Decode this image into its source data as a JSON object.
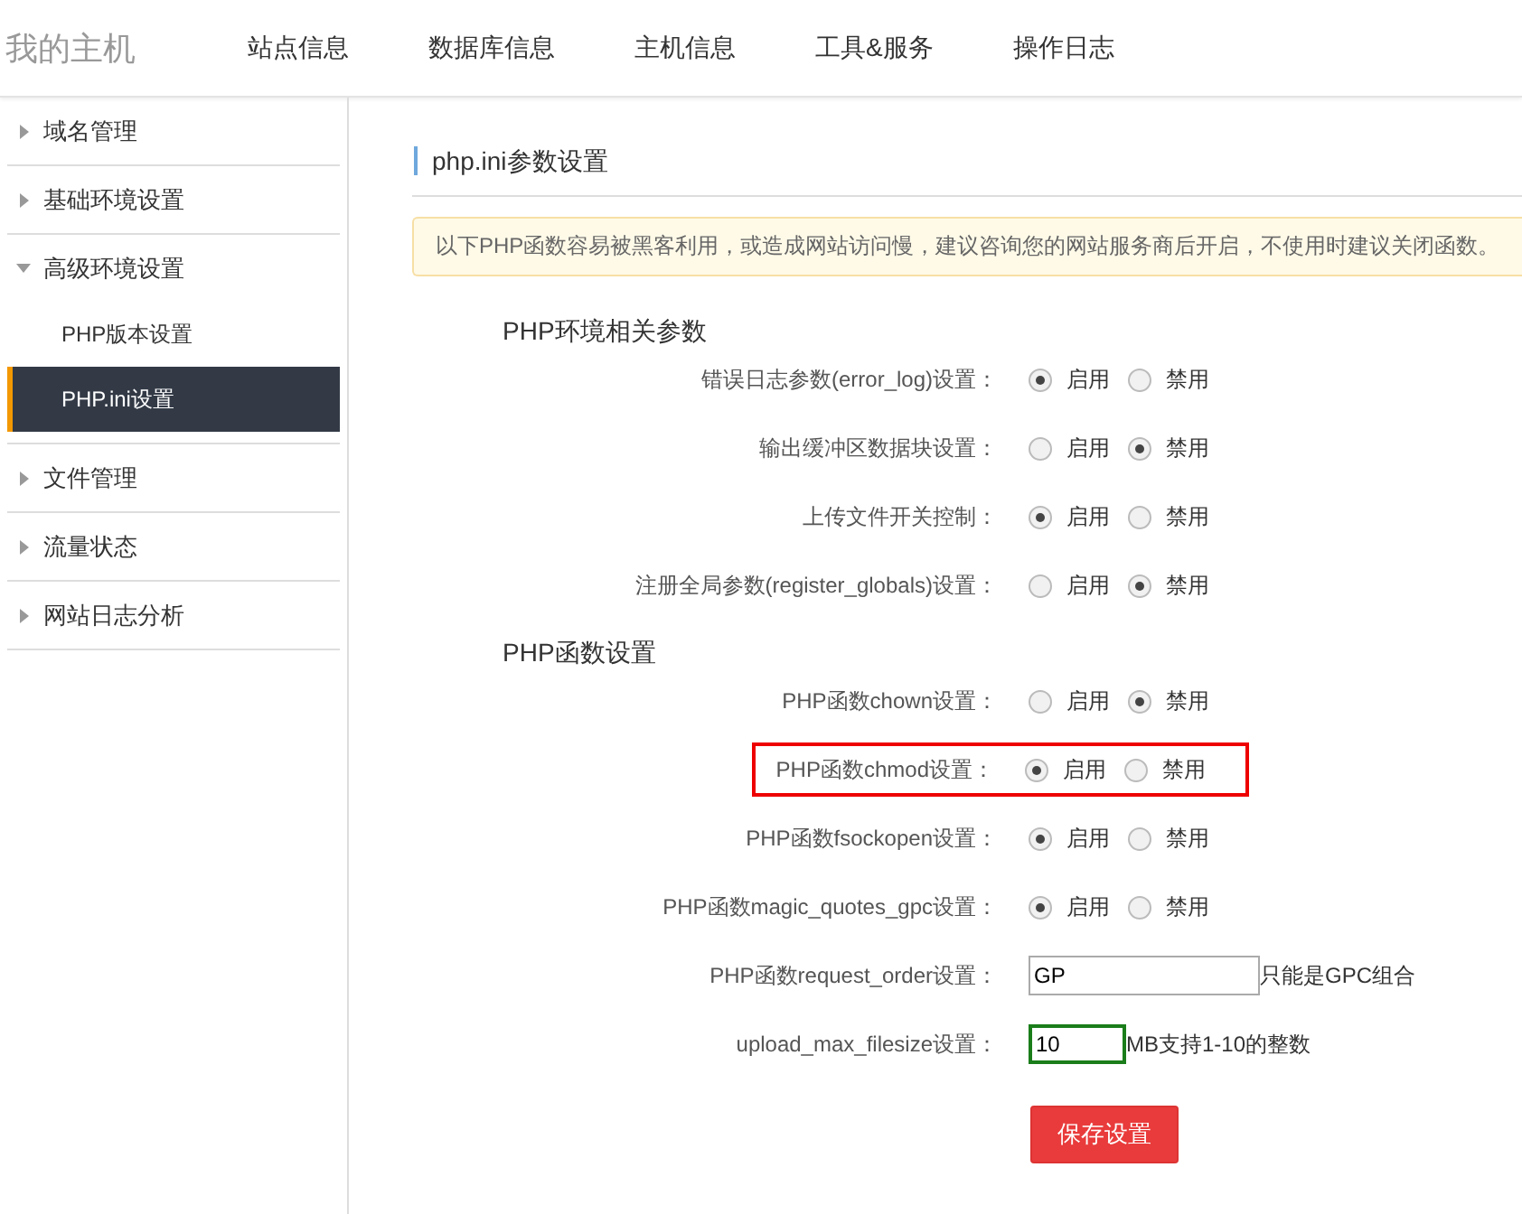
{
  "header": {
    "title": "我的主机",
    "nav": [
      {
        "label": "站点信息"
      },
      {
        "label": "数据库信息"
      },
      {
        "label": "主机信息"
      },
      {
        "label": "工具&服务"
      },
      {
        "label": "操作日志"
      }
    ]
  },
  "sidebar": {
    "items": [
      {
        "label": "域名管理",
        "expanded": false
      },
      {
        "label": "基础环境设置",
        "expanded": false
      },
      {
        "label": "高级环境设置",
        "expanded": true,
        "children": [
          {
            "label": "PHP版本设置",
            "selected": false
          },
          {
            "label": "PHP.ini设置",
            "selected": true
          }
        ]
      },
      {
        "label": "文件管理",
        "expanded": false
      },
      {
        "label": "流量状态",
        "expanded": false
      },
      {
        "label": "网站日志分析",
        "expanded": false
      }
    ]
  },
  "page": {
    "title": "php.ini参数设置",
    "notice": "以下PHP函数容易被黑客利用，或造成网站访问慢，建议咨询您的网站服务商后开启，不使用时建议关闭函数。",
    "sections": [
      {
        "heading": "PHP环境相关参数",
        "rows": [
          {
            "kind": "radio",
            "label": "错误日志参数(error_log)设置：",
            "highlighted": false,
            "options": [
              {
                "label": "启用",
                "selected": true
              },
              {
                "label": "禁用",
                "selected": false
              }
            ]
          },
          {
            "kind": "radio",
            "label": "输出缓冲区数据块设置：",
            "highlighted": false,
            "options": [
              {
                "label": "启用",
                "selected": false
              },
              {
                "label": "禁用",
                "selected": true
              }
            ]
          },
          {
            "kind": "radio",
            "label": "上传文件开关控制：",
            "highlighted": false,
            "options": [
              {
                "label": "启用",
                "selected": true
              },
              {
                "label": "禁用",
                "selected": false
              }
            ]
          },
          {
            "kind": "radio",
            "label": "注册全局参数(register_globals)设置：",
            "highlighted": false,
            "options": [
              {
                "label": "启用",
                "selected": false
              },
              {
                "label": "禁用",
                "selected": true
              }
            ]
          }
        ]
      },
      {
        "heading": "PHP函数设置",
        "rows": [
          {
            "kind": "radio",
            "label": "PHP函数chown设置：",
            "highlighted": false,
            "options": [
              {
                "label": "启用",
                "selected": false
              },
              {
                "label": "禁用",
                "selected": true
              }
            ]
          },
          {
            "kind": "radio",
            "label": "PHP函数chmod设置：",
            "highlighted": true,
            "options": [
              {
                "label": "启用",
                "selected": true
              },
              {
                "label": "禁用",
                "selected": false
              }
            ]
          },
          {
            "kind": "radio",
            "label": "PHP函数fsockopen设置：",
            "highlighted": false,
            "options": [
              {
                "label": "启用",
                "selected": true
              },
              {
                "label": "禁用",
                "selected": false
              }
            ]
          },
          {
            "kind": "radio",
            "label": "PHP函数magic_quotes_gpc设置：",
            "highlighted": false,
            "options": [
              {
                "label": "启用",
                "selected": true
              },
              {
                "label": "禁用",
                "selected": false
              }
            ]
          },
          {
            "kind": "text",
            "label": "PHP函数request_order设置：",
            "value": "GP",
            "focused": false,
            "wide": true,
            "hint": "只能是GPC组合"
          },
          {
            "kind": "text",
            "label": "upload_max_filesize设置：",
            "value": "10",
            "focused": true,
            "wide": false,
            "hint": "MB支持1-10的整数"
          }
        ]
      }
    ],
    "save_button": "保存设置"
  }
}
